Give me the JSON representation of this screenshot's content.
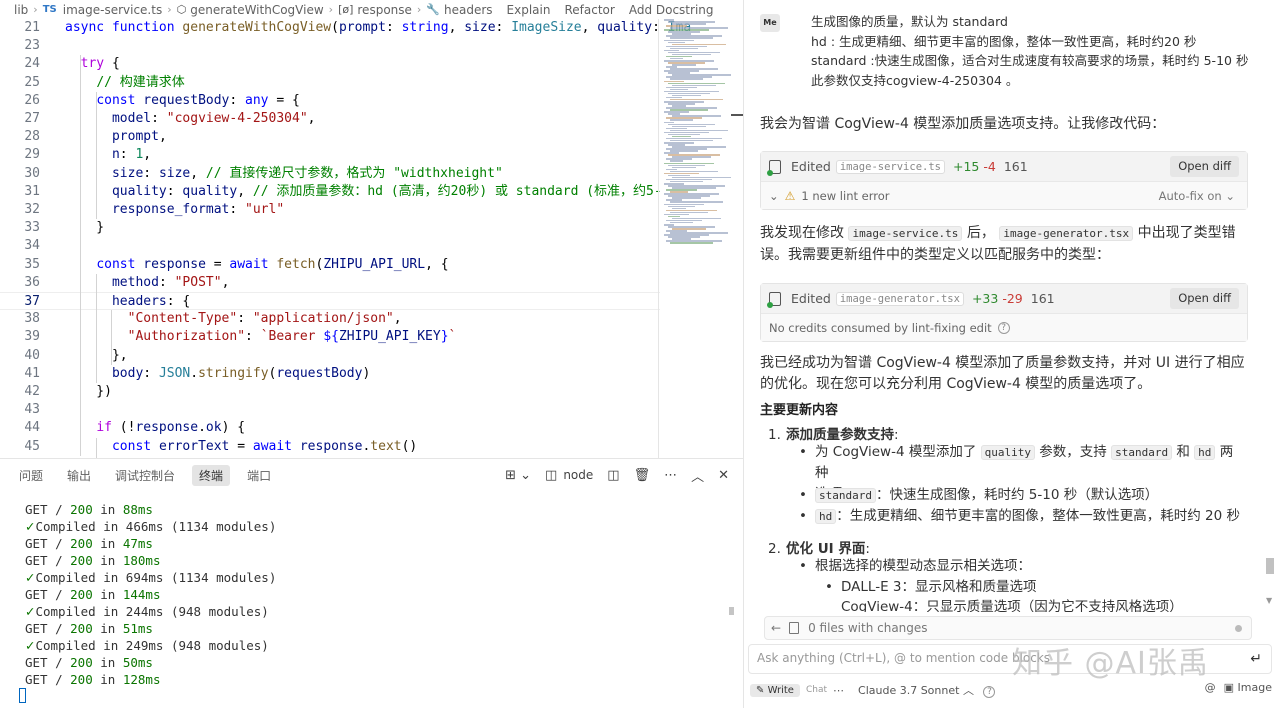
{
  "breadcrumb": {
    "folder": "lib",
    "file_badge": "TS",
    "file": "image-service.ts",
    "symbol": "generateWithCogView",
    "var1": "response",
    "var2": "headers",
    "actions": [
      "Explain",
      "Refactor",
      "Add Docstring"
    ]
  },
  "code_lines": [
    {
      "n": "21",
      "text": "async function generateWithCogView(prompt: string, size: ImageSize, quality: Ima"
    },
    {
      "n": "23",
      "text": ""
    },
    {
      "n": "24",
      "text": "  try {"
    },
    {
      "n": "25",
      "text": "    // 构建请求体"
    },
    {
      "n": "26",
      "text": "    const requestBody: any = {"
    },
    {
      "n": "27",
      "text": "      model: \"cogview-4-250304\","
    },
    {
      "n": "28",
      "text": "      prompt,"
    },
    {
      "n": "29",
      "text": "      n: 1,"
    },
    {
      "n": "30",
      "text": "      size: size, // 直接传递尺寸参数，格式为 \"widthxheight\""
    },
    {
      "n": "31",
      "text": "      quality: quality, // 添加质量参数：hd (高清，约20秒) 或 standard (标准，约5-"
    },
    {
      "n": "32",
      "text": "      response_format: \"url\""
    },
    {
      "n": "33",
      "text": "    }"
    },
    {
      "n": "34",
      "text": ""
    },
    {
      "n": "35",
      "text": "    const response = await fetch(ZHIPU_API_URL, {"
    },
    {
      "n": "36",
      "text": "      method: \"POST\","
    },
    {
      "n": "37",
      "text": "      headers: {"
    },
    {
      "n": "38",
      "text": "        \"Content-Type\": \"application/json\","
    },
    {
      "n": "39",
      "text": "        \"Authorization\": `Bearer ${ZHIPU_API_KEY}`"
    },
    {
      "n": "40",
      "text": "      },"
    },
    {
      "n": "41",
      "text": "      body: JSON.stringify(requestBody)"
    },
    {
      "n": "42",
      "text": "    })"
    },
    {
      "n": "43",
      "text": ""
    },
    {
      "n": "44",
      "text": "    if (!response.ok) {"
    },
    {
      "n": "45",
      "text": "      const errorText = await response.text()"
    }
  ],
  "panel": {
    "tabs": [
      "问题",
      "输出",
      "调试控制台",
      "终端",
      "端口"
    ],
    "active_tab": "终端",
    "terminal_name": "node"
  },
  "terminal_lines": [
    {
      "kind": "get",
      "status": "200",
      "time": "88ms"
    },
    {
      "kind": "compiled",
      "time": "466ms",
      "modules": "1134 modules"
    },
    {
      "kind": "get",
      "status": "200",
      "time": "47ms"
    },
    {
      "kind": "get",
      "status": "200",
      "time": "180ms"
    },
    {
      "kind": "compiled",
      "time": "694ms",
      "modules": "1134 modules"
    },
    {
      "kind": "get",
      "status": "200",
      "time": "144ms"
    },
    {
      "kind": "compiled",
      "time": "244ms",
      "modules": "948 modules"
    },
    {
      "kind": "get",
      "status": "200",
      "time": "51ms"
    },
    {
      "kind": "compiled",
      "time": "249ms",
      "modules": "948 modules"
    },
    {
      "kind": "get",
      "status": "200",
      "time": "50ms"
    },
    {
      "kind": "get",
      "status": "200",
      "time": "128ms"
    }
  ],
  "chat": {
    "user_avatar": "Me",
    "user_lines": [
      "生成图像的质量，默认为 standard",
      "hd : 生成更精细、细节更丰富的图像，整体一致性更高，耗时约20 秒",
      "standard :快速生成图像，适合对生成速度有较高要求的场景，耗时约 5-10 秒",
      "此参数仅支持cogview-4-250304 。"
    ],
    "intro": "我会为智谱 CogView-4 模型添加质量选项支持。让我修改代码：",
    "edit1": {
      "label": "Edited",
      "file": "image-service.ts",
      "plus": "+15",
      "minus": "-4",
      "lines": "161",
      "button": "Open diff",
      "sub": "1 new lint error",
      "autofix": "Auto-fix on"
    },
    "para2_a": "我发现在修改",
    "para2_chip1": "image-service.ts",
    "para2_b": "后，",
    "para2_chip2": "image-generator.tsx",
    "para2_c": "中出现了类型错误。我需要更新组件中的类型定义以匹配服务中的类型：",
    "edit2": {
      "label": "Edited",
      "file": "image-generator.tsx",
      "plus": "+33",
      "minus": "-29",
      "lines": "161",
      "button": "Open diff",
      "sub": "No credits consumed by lint-fixing edit"
    },
    "summary": "我已经成功为智谱 CogView-4 模型添加了质量参数支持，并对 UI 进行了相应的优化。现在您可以充分利用 CogView-4 模型的质量选项了。",
    "section_title": "主要更新内容",
    "item1": {
      "n": "1.",
      "title": "添加质量参数支持",
      "colon": ":",
      "b1_a": "为 CogView-4 模型添加了",
      "b1_chip1": "quality",
      "b1_b": "参数，支持",
      "b1_chip2": "standard",
      "b1_c": "和",
      "b1_chip3": "hd",
      "b1_d": "两种",
      "b1_e": "选项",
      "b2_chip": "standard",
      "b2_text": "：快速生成图像，耗时约 5-10 秒（默认选项）",
      "b3_chip": "hd",
      "b3_text": "：生成更精细、细节更丰富的图像，整体一致性更高，耗时约 20 秒"
    },
    "item2": {
      "n": "2.",
      "title": "优化 UI 界面",
      "colon": ":",
      "b1": "根据选择的模型动态显示相关选项：",
      "s1": "DALL-E 3：显示风格和质量选项",
      "s2": "CogView-4：只显示质量选项（因为它不支持风格选项）"
    },
    "files_bar": "0 files with changes",
    "input_placeholder": "Ask anything (Ctrl+L), @ to mention code blocks",
    "watermark": "知乎 @AI张禹",
    "mode_write": "Write",
    "mode_chat": "Chat",
    "model": "Claude 3.7 Sonnet",
    "image_label": "Image"
  }
}
